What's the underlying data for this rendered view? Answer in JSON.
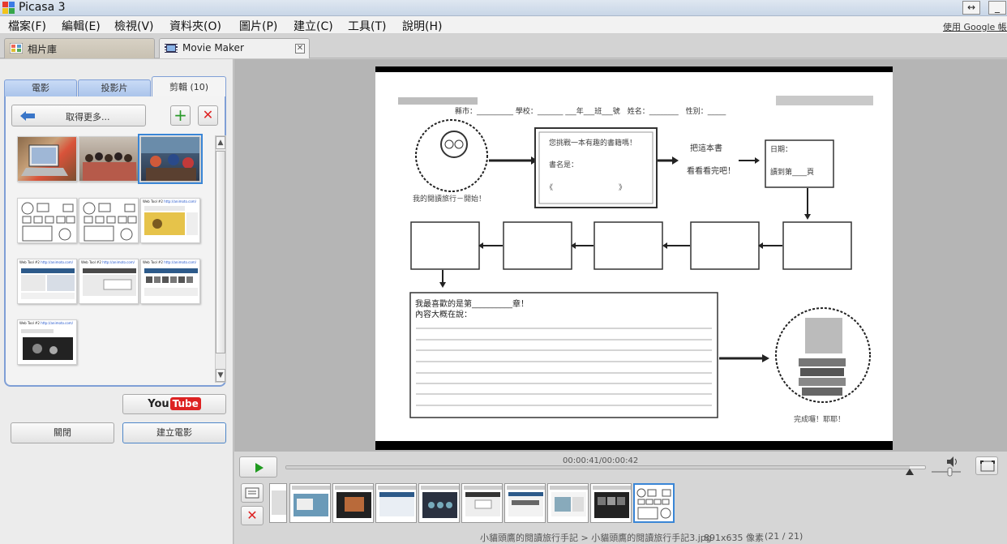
{
  "window": {
    "title": "Picasa 3",
    "resize_icon": "↔",
    "minimize_icon": "_"
  },
  "menu": {
    "items": [
      "檔案(F)",
      "編輯(E)",
      "檢視(V)",
      "資料夾(O)",
      "圖片(P)",
      "建立(C)",
      "工具(T)",
      "說明(H)"
    ],
    "login_link": "使用 Google 帳戶登入"
  },
  "tabs": {
    "library": "相片庫",
    "movie_maker": "Movie Maker",
    "close_icon": "✕"
  },
  "left_panel": {
    "subtabs": [
      "電影",
      "投影片",
      "剪輯 (10)"
    ],
    "active_subtab": "剪輯 (10)",
    "get_more": "取得更多...",
    "add_icon": "+",
    "remove_icon": "✕",
    "thumb_captions": {
      "web_tool_label": "Web Tool #2",
      "web_tool_url": "http://animoto.com/"
    },
    "youtube": {
      "you": "You",
      "tube": "Tube"
    },
    "close_button": "關閉",
    "create_button": "建立電影"
  },
  "slide": {
    "row1": "縣市：__________ 學校：_______ ___年___班___號　姓名：________　性別：_____",
    "box1": "您挑戰一本有趣的書籍嗎！",
    "box1_line2": "書名是：",
    "box1_brackets": "《　　　　　　　　　》",
    "arrow_text_1": "把這本書",
    "arrow_text_2": "看看看完吧！",
    "date_box": "日期：",
    "date_box_2": "讀到第____頁",
    "left_caption": "我的閱讀旅行－開始！",
    "big_box_line1": "我最喜歡的是第__________章！",
    "big_box_line2": "內容大概在說：",
    "bottom_caption": "完成囉！耶耶！"
  },
  "player": {
    "timecode": "00:00:41/00:00:42",
    "progress": 0.976,
    "volume_icon": "speaker-icon"
  },
  "status": {
    "path": "小貓頭鷹的閱讀旅行手記 > 小貓頭鷹的閱讀旅行手記3.jpg",
    "size": "891x635 像素",
    "count": "(21 / 21)"
  },
  "colors": {
    "accent": "#3a86d6",
    "subtab_blue": "#a9c3ea",
    "youtube_red": "#dd2222",
    "remove_red": "#dd2222",
    "add_green": "#2a9a2a",
    "play_green": "#1f9a1f"
  }
}
